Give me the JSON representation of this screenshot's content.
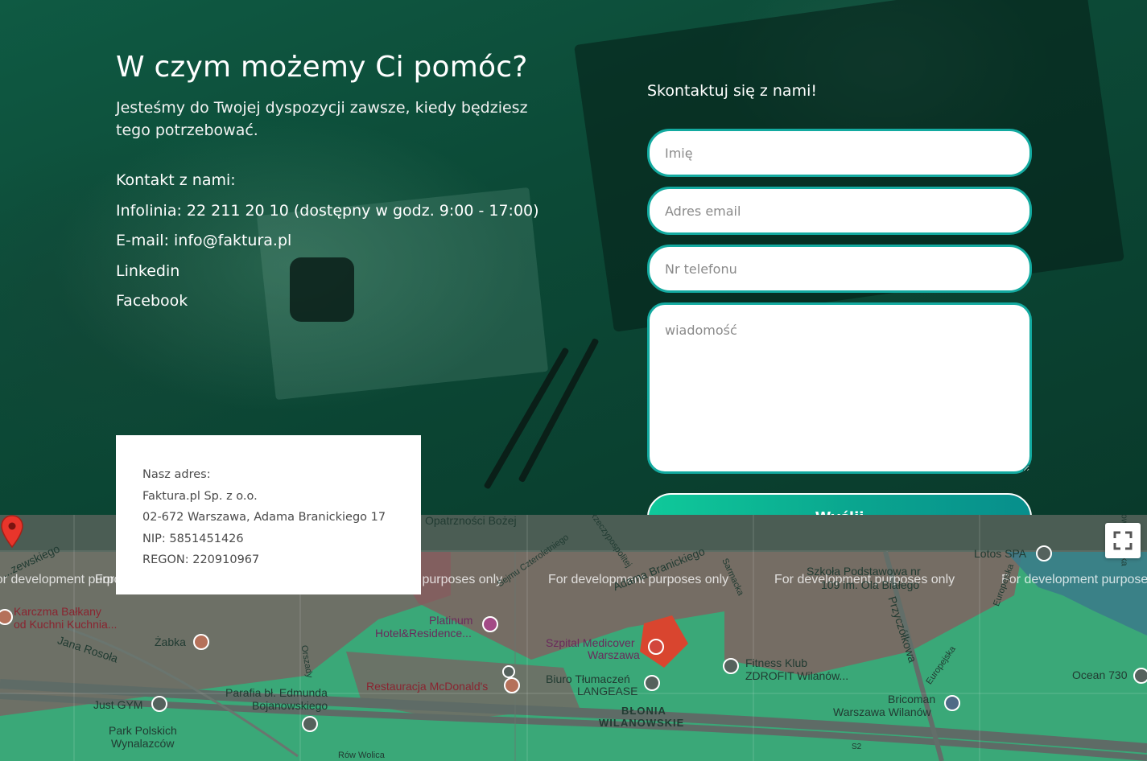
{
  "hero": {
    "title": "W czym możemy Ci pomóc?",
    "subtitle": "Jesteśmy do Twojej dyspozycji zawsze, kiedy będziesz tego potrzebować.",
    "contact_heading": "Kontakt z nami:",
    "infoline": "Infolinia: 22 211 20 10 (dostępny w godz. 9:00 - 17:00)",
    "email": "E-mail: info@faktura.pl",
    "linkedin": "Linkedin",
    "facebook": "Facebook"
  },
  "form": {
    "title": "Skontaktuj się z nami!",
    "name_placeholder": "Imię",
    "email_placeholder": "Adres email",
    "phone_placeholder": "Nr telefonu",
    "message_placeholder": "wiadomość",
    "submit_label": "Wyślij"
  },
  "address": {
    "label": "Nasz adres:",
    "company": "Faktura.pl Sp. z o.o.",
    "street": "02-672 Warszawa, Adama Branickiego 17",
    "nip": "NIP: 5851451426",
    "regon": "REGON: 220910967"
  },
  "map": {
    "dev_note": "For development purposes only",
    "labels": {
      "opatrznosci": "Opatrzności Bożej",
      "rzeczypospolitej": "Aleja Rzeczypospolitej",
      "czteroletniego": "Sejmu Czteroletniego",
      "branickiego": "Adama Branickiego",
      "sarmacka": "Sarmacka",
      "szkola": "Szkoła Podstawowa nr",
      "szkola2": "109 im. Ola Białego",
      "lotos": "Lotos SPA",
      "przyczolkowa": "Przyczółkowa",
      "europejska": "Europejska",
      "karczma1": "Karczma Bałkany",
      "karczma2": "od Kuchni Kuchnia...",
      "zabka": "Żabka",
      "rosola": "Jana Rosoła",
      "platinum1": "Platinum",
      "platinum2": "Hotel&Residence...",
      "szpital1": "Szpital Medicover",
      "szpital2": "Warszawa",
      "biuro": "Biuro Tłumaczeń",
      "langease": "LANGEASE",
      "mcd": "Restauracja McDonald's",
      "fitness1": "Fitness Klub",
      "fitness2": "ZDROFIT Wilanów...",
      "parafia1": "Parafia bł. Edmunda",
      "parafia2": "Bojanowskiego",
      "justgym": "Just GYM",
      "park1": "Park Polskich",
      "park2": "Wynalazców",
      "blonia1": "BŁONIA",
      "blonia2": "WILANOWSKIE",
      "bricoman1": "Bricoman",
      "bricoman2": "Warszawa Wilanów",
      "ocean": "Ocean 730",
      "orszady": "Orszady",
      "wolica": "Rów Wolica",
      "s2": "S2",
      "zewskiego": "...zewskiego",
      "owsinkowsk": "Powsinkowska"
    }
  }
}
